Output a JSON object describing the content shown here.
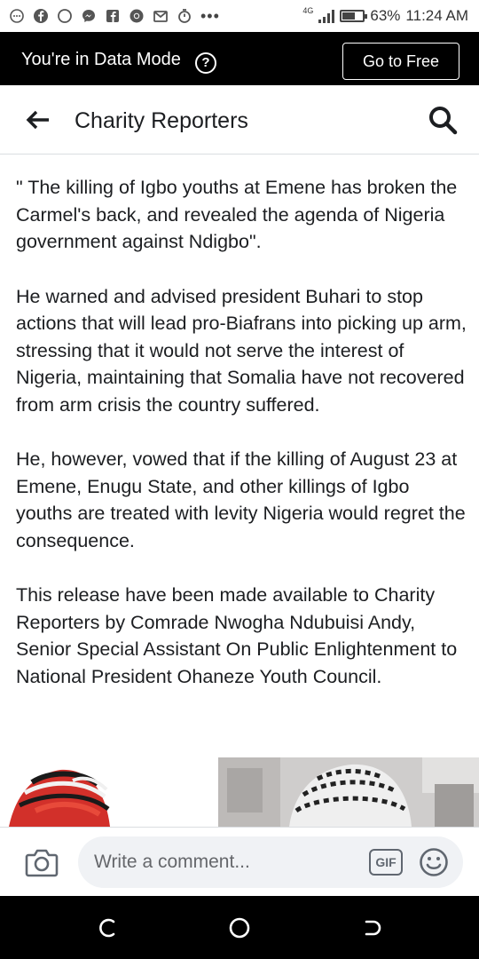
{
  "status_bar": {
    "network": "4G",
    "battery": "63%",
    "battery_level": 0.63,
    "time": "11:24 AM",
    "icons": [
      "facebook-icon",
      "circle-icon",
      "messenger-icon",
      "facebook-square-icon",
      "chrome-icon",
      "mail-icon",
      "stopwatch-icon",
      "more-icon"
    ]
  },
  "data_banner": {
    "text": "You're in Data Mode",
    "help_glyph": "?",
    "go_free_label": "Go to Free"
  },
  "header": {
    "title": "Charity Reporters",
    "back_icon": "back-arrow-icon",
    "search_icon": "search-icon"
  },
  "article": {
    "paragraphs": [
      "\" The killing of Igbo youths at Emene has broken the Carmel's back, and revealed the agenda of Nigeria government against Ndigbo\".",
      "He warned and advised president Buhari to stop actions that will lead pro-Biafrans into picking up arm, stressing that it would not serve the interest of Nigeria,  maintaining that Somalia have not recovered from arm crisis the country suffered.",
      "He, however, vowed that if the killing of August 23 at Emene, Enugu State, and other killings of Igbo youths are treated with levity Nigeria would regret the consequence.",
      "This release have been made available to Charity Reporters by Comrade Nwogha Ndubuisi Andy, Senior Special Assistant On Public Enlightenment to National President Ohaneze Youth Council."
    ]
  },
  "comment_bar": {
    "placeholder": "Write a comment...",
    "gif_label": "GIF",
    "camera_icon": "camera-icon",
    "emoji_icon": "emoji-icon"
  },
  "nav_bar": {
    "buttons": [
      "recent-apps-button",
      "home-button",
      "back-button"
    ]
  }
}
